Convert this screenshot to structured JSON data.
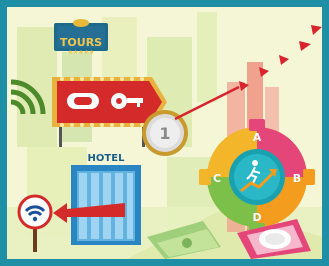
{
  "sign_tours": {
    "label": "TOURS"
  },
  "hotel": {
    "label": "HOTEL"
  },
  "gear": {
    "labels": {
      "a": "A",
      "b": "B",
      "c": "C",
      "d": "D"
    }
  },
  "coin": {
    "label": "1"
  },
  "colors": {
    "frame": "#1f8fa6",
    "sign_red": "#d42a2a",
    "coin_gold": "#d9b63c",
    "gear_orange": "#f39c1e",
    "gear_pink": "#e4467a",
    "gear_green": "#7cc04a",
    "gear_teal": "#1aa1b0",
    "arrow_red": "#d9232d"
  },
  "icons": [
    "wifi-icon",
    "growth-arrow-icon",
    "runner-icon",
    "plate-icon",
    "banknote-icon",
    "key-icon"
  ]
}
